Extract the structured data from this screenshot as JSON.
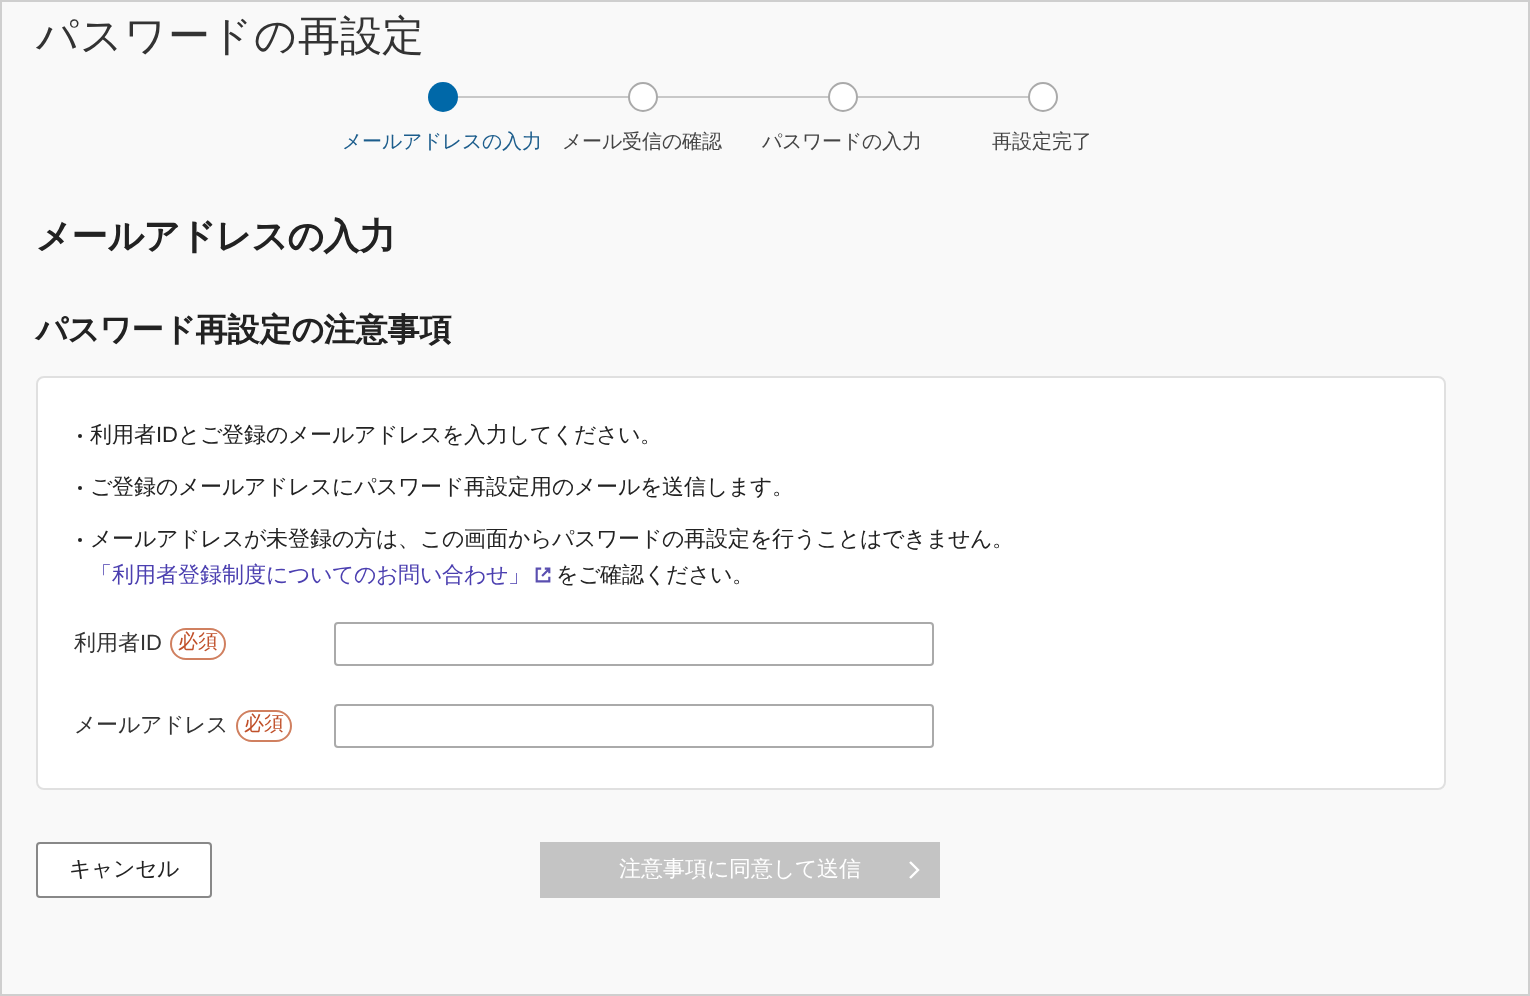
{
  "title": "パスワードの再設定",
  "steps": [
    {
      "label": "メールアドレスの入力",
      "selected": true
    },
    {
      "label": "メール受信の確認",
      "selected": false
    },
    {
      "label": "パスワードの入力",
      "selected": false
    },
    {
      "label": "再設定完了",
      "selected": false
    }
  ],
  "section_heading": "メールアドレスの入力",
  "notice": {
    "heading": "パスワード再設定の注意事項",
    "items": [
      {
        "text": "利用者IDとご登録のメールアドレスを入力してください。"
      },
      {
        "text": "ご登録のメールアドレスにパスワード再設定用のメールを送信します。"
      },
      {
        "text": "メールアドレスが未登録の方は、この画面からパスワードの再設定を行うことはできません。",
        "link": "「利用者登録制度についてのお問い合わせ」",
        "after": "をご確認ください。"
      }
    ]
  },
  "fields": [
    {
      "label": "利用者ID",
      "badge": "必須"
    },
    {
      "label": "メールアドレス",
      "badge": "必須"
    }
  ],
  "buttons": {
    "cancel": "キャンセル",
    "submit": {
      "label": "注意事項に同意して送信",
      "disabled": true
    }
  }
}
